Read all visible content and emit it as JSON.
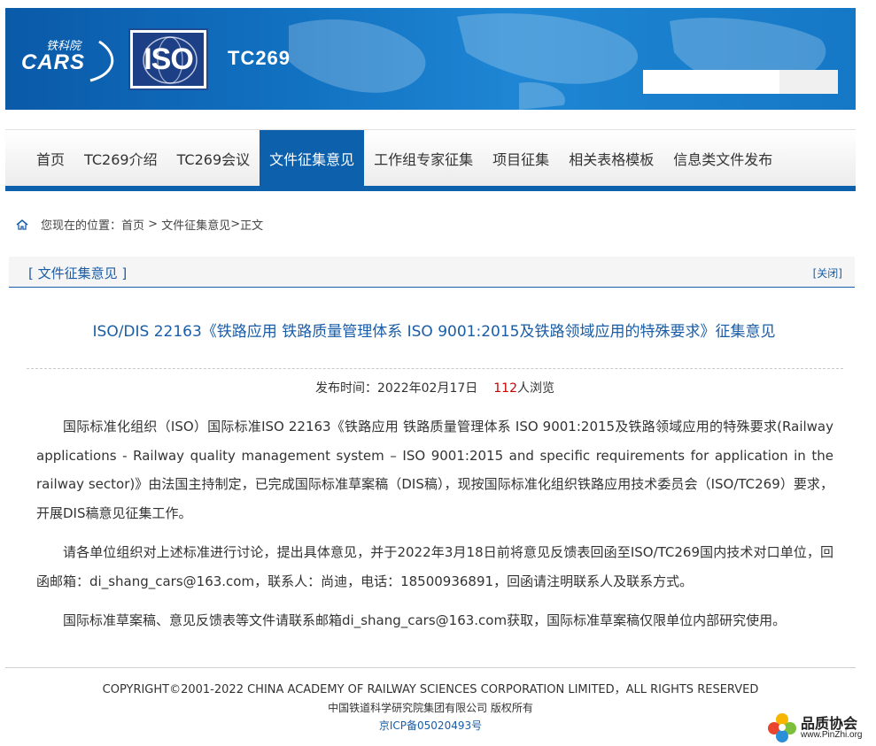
{
  "header": {
    "logo_cn": "铁科院",
    "logo_en": "CARS",
    "iso_logo": "ISO",
    "site_title": "TC269",
    "search_placeholder": ""
  },
  "nav": {
    "items": [
      {
        "label": "首页",
        "active": false
      },
      {
        "label": "TC269介绍",
        "active": false
      },
      {
        "label": "TC269会议",
        "active": false
      },
      {
        "label": "文件征集意见",
        "active": true
      },
      {
        "label": "工作组专家征集",
        "active": false
      },
      {
        "label": "项目征集",
        "active": false
      },
      {
        "label": "相关表格模板",
        "active": false
      },
      {
        "label": "信息类文件发布",
        "active": false
      }
    ]
  },
  "breadcrumb": {
    "prefix": "您现在的位置：",
    "home": "首页",
    "sep1": " > ",
    "section": "文件征集意见",
    "sep2": ">",
    "current": "正文"
  },
  "panel": {
    "title": "[ 文件征集意见 ]",
    "close": "[关闭]"
  },
  "article": {
    "title": "ISO/DIS 22163《铁路应用 铁路质量管理体系 ISO 9001:2015及铁路领域应用的特殊要求》征集意见",
    "publish_label": "发布时间：2022年02月17日",
    "views_count": "112",
    "views_suffix": "人浏览",
    "paragraphs": [
      "国际标准化组织（ISO）国际标准ISO 22163《铁路应用 铁路质量管理体系 ISO 9001:2015及铁路领域应用的特殊要求(Railway applications - Railway quality management system – ISO 9001:2015 and specific requirements for application in the railway sector)》由法国主持制定，已完成国际标准草案稿（DIS稿），现按国际标准化组织铁路应用技术委员会（ISO/TC269）要求，开展DIS稿意见征集工作。",
      "请各单位组织对上述标准进行讨论，提出具体意见，并于2022年3月18日前将意见反馈表回函至ISO/TC269国内技术对口单位，回函邮箱：di_shang_cars@163.com，联系人：尚迪，电话：18500936891，回函请注明联系人及联系方式。",
      "国际标准草案稿、意见反馈表等文件请联系邮箱di_shang_cars@163.com获取，国际标准草案稿仅限单位内部研究使用。"
    ]
  },
  "footer": {
    "copyright": "COPYRIGHT©2001-2022 CHINA ACADEMY OF RAILWAY SCIENCES CORPORATION LIMITED，ALL RIGHTS RESERVED",
    "company": "中国铁道科学研究院集团有限公司 版权所有",
    "icp": "京ICP备05020493号"
  },
  "watermark": {
    "name": "品质协会",
    "url": "www.PinZhi.org"
  },
  "colors": {
    "brand_blue": "#0c60ac",
    "link_blue": "#1a5da6",
    "count_red": "#cc0000"
  }
}
